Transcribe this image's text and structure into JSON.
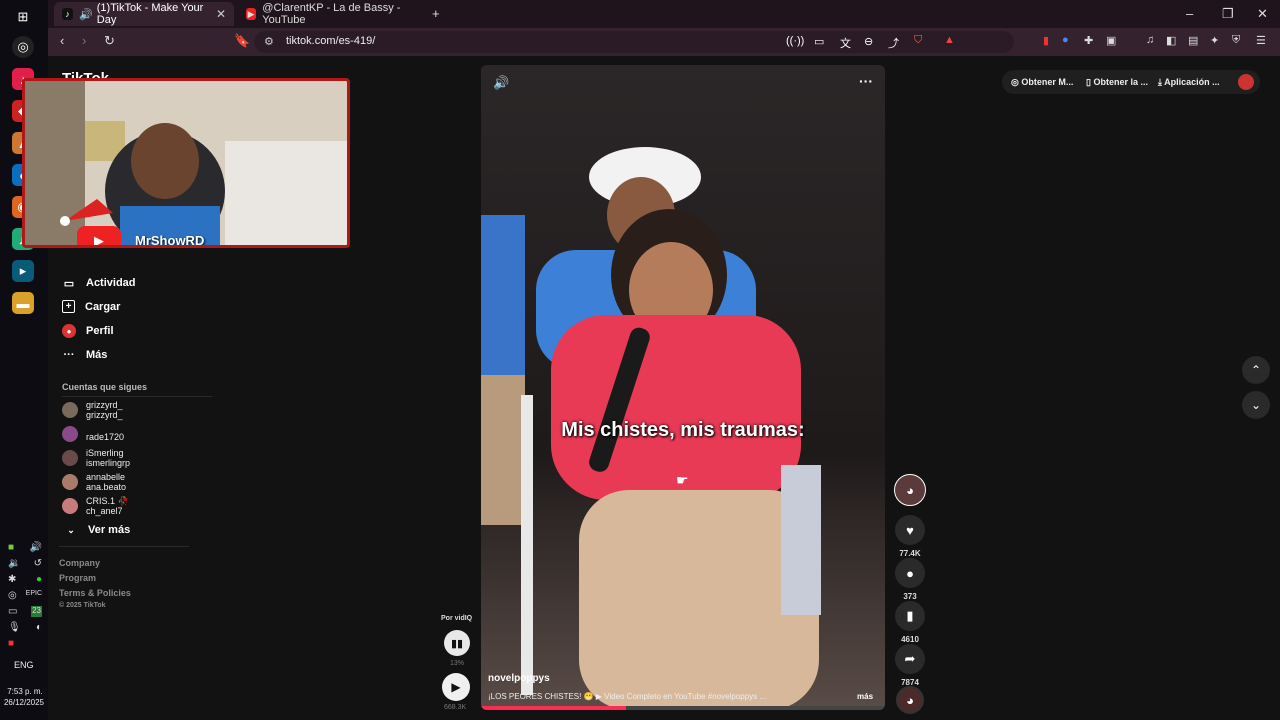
{
  "taskbar": {
    "language": "ENG",
    "time": "7:53 p. m.",
    "date": "26/12/2025",
    "tray_numbers": [
      "23"
    ]
  },
  "browser": {
    "tabs": [
      {
        "title": "(1)TikTok - Make Your Day",
        "active": true
      },
      {
        "title": "@ClarentKP - La de Bassy - YouTube",
        "active": false
      }
    ],
    "url": "tiktok.com/es-419/"
  },
  "sidebar": {
    "logo_text": "TikTok",
    "nav_items": [
      {
        "label": "Actividad",
        "icon": "activity-icon"
      },
      {
        "label": "Cargar",
        "icon": "upload-icon"
      },
      {
        "label": "Perfil",
        "icon": "profile-icon"
      },
      {
        "label": "Más",
        "icon": "more-icon"
      }
    ],
    "following_header": "Cuentas que sigues",
    "following": [
      {
        "line1": "grizzyrd_",
        "line2": "grizzyrd_",
        "color": "#7a6a5a"
      },
      {
        "line1": "rade1720",
        "line2": "",
        "color": "#8a4a8a"
      },
      {
        "line1": "iSmerling",
        "line2": "ismerlingrp",
        "color": "#6a4a4a"
      },
      {
        "line1": "annabelle",
        "line2": "ana.beato",
        "color": "#aa7a6a"
      },
      {
        "line1": "CRIS.1 🥀",
        "line2": "ch_anel7",
        "color": "#c97a7a"
      }
    ],
    "see_more": "Ver más",
    "footer": [
      "Company",
      "Program",
      "Terms & Policies",
      "© 2025 TikTok"
    ]
  },
  "top_actions": {
    "get_coins": "Obtener M...",
    "get_app": "Obtener la ...",
    "application": "Aplicación ..."
  },
  "webcam": {
    "channel_name": "MrShowRD"
  },
  "video": {
    "caption": "Mis chistes, mis traumas:",
    "author": "novelpoppys",
    "description": "¡LOS PEORES CHISTES! 😬 ▶ Video Completo en YouTube #novelpoppys ...",
    "more": "más",
    "stats": {
      "likes": "77.4K",
      "comments": "373",
      "saves": "4610",
      "shares": "7874"
    }
  },
  "mini_player": {
    "by_label": "Por vidIQ",
    "percent": "13%",
    "views": "668.3K"
  },
  "colors": {
    "accent": "#fe2c55",
    "page_bg": "#121212",
    "tab_bg": "#1f141c",
    "toolbar_bg": "#35222f"
  }
}
